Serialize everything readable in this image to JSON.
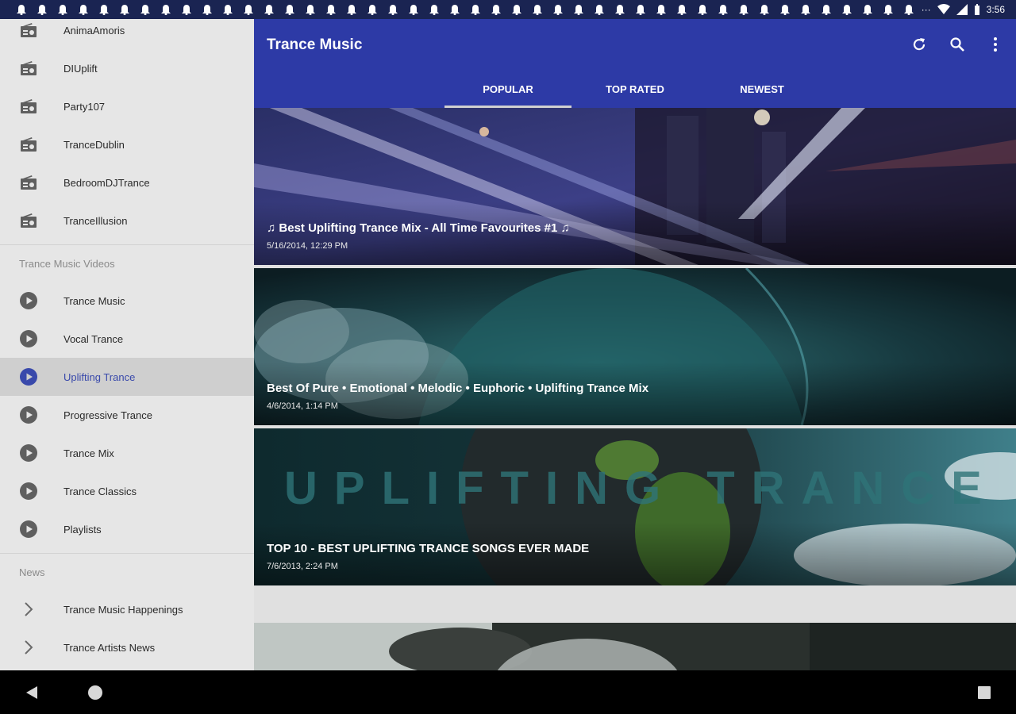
{
  "status_bar": {
    "time": "3:56",
    "notification_icon": "bell-icon",
    "notification_count": 44
  },
  "drawer": {
    "stations": [
      {
        "label": "AnimaAmoris",
        "icon": "radio-icon"
      },
      {
        "label": "DIUplift",
        "icon": "radio-icon"
      },
      {
        "label": "Party107",
        "icon": "radio-icon"
      },
      {
        "label": "TranceDublin",
        "icon": "radio-icon"
      },
      {
        "label": "BedroomDJTrance",
        "icon": "radio-icon"
      },
      {
        "label": "TranceIllusion",
        "icon": "radio-icon"
      }
    ],
    "videos_header": "Trance Music Videos",
    "videos": [
      {
        "label": "Trance Music",
        "icon": "play-circle-icon"
      },
      {
        "label": "Vocal Trance",
        "icon": "play-circle-icon"
      },
      {
        "label": "Uplifting Trance",
        "icon": "play-circle-icon",
        "active": true
      },
      {
        "label": "Progressive Trance",
        "icon": "play-circle-icon"
      },
      {
        "label": "Trance Mix",
        "icon": "play-circle-icon"
      },
      {
        "label": "Trance Classics",
        "icon": "play-circle-icon"
      },
      {
        "label": "Playlists",
        "icon": "play-circle-icon"
      }
    ],
    "news_header": "News",
    "news": [
      {
        "label": "Trance Music Happenings",
        "icon": "chevron-right-icon"
      },
      {
        "label": "Trance Artists News",
        "icon": "chevron-right-icon"
      }
    ]
  },
  "appbar": {
    "title": "Trance Music"
  },
  "tabs": [
    {
      "label": "POPULAR",
      "selected": true
    },
    {
      "label": "TOP RATED",
      "selected": false
    },
    {
      "label": "NEWEST",
      "selected": false
    }
  ],
  "feed": [
    {
      "title": "♫ Best Uplifting Trance Mix - All Time Favourites #1 ♫",
      "date": "5/16/2014, 12:29 PM"
    },
    {
      "title": "Best Of Pure • Emotional • Melodic • Euphoric • Uplifting Trance Mix",
      "date": "4/6/2014, 1:14 PM"
    },
    {
      "title": "TOP 10 - BEST UPLIFTING TRANCE SONGS EVER MADE",
      "date": "7/6/2013, 2:24 PM",
      "art_text": "UPLIFTING TRANCE"
    }
  ],
  "colors": {
    "appbar": "#2d3aa6",
    "active_item": "#3949ab",
    "drawer_bg": "#e6e6e6",
    "statusbar": "#1a2452"
  }
}
